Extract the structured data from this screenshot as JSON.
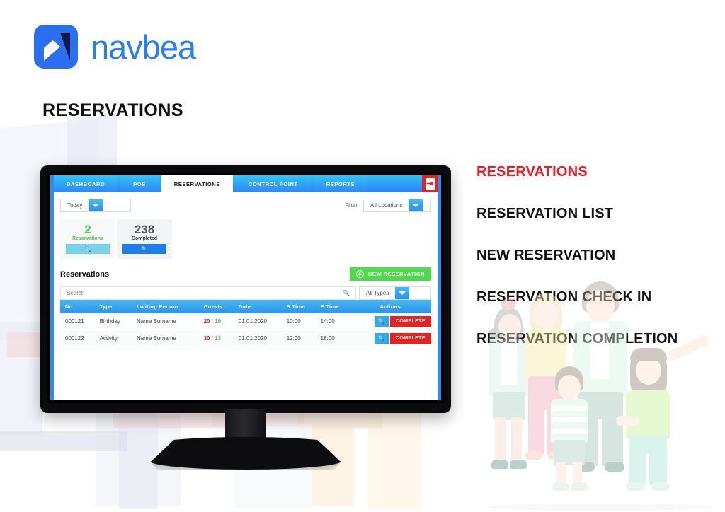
{
  "brand": {
    "name": "navbea",
    "logo_icon": "navbea-arrow-logo",
    "logo_bg": "#2a6ff0",
    "text_color": "#2a7ef0"
  },
  "page_title": "RESERVATIONS",
  "app": {
    "nav_tabs": [
      {
        "label": "DASHBOARD",
        "active": false
      },
      {
        "label": "POS",
        "active": false
      },
      {
        "label": "RESERVATIONS",
        "active": true
      },
      {
        "label": "CONTROL POINT",
        "active": false
      },
      {
        "label": "REPORTS",
        "active": false
      }
    ],
    "exit_icon": "exit-door-icon",
    "toolbar": {
      "date_select": {
        "value": "Today",
        "caret_icon": "chevron-down-icon"
      },
      "filter_label": "Filter",
      "location_select": {
        "value": "All Locations",
        "caret_icon": "chevron-down-icon"
      }
    },
    "stats": [
      {
        "value": "2",
        "label": "Reservations",
        "color": "#4ec44e",
        "button_icon": "search-icon",
        "button_color": "#77d0ec"
      },
      {
        "value": "238",
        "label": "Completed",
        "color": "#555a60",
        "button_icon": "search-icon",
        "button_color": "#1b7ef0"
      }
    ],
    "section": {
      "title": "Reservations",
      "new_button": {
        "label": "NEW RESERVATION",
        "icon": "plus-circle-icon",
        "color": "#4ddb4d"
      }
    },
    "search": {
      "placeholder": "Search",
      "value": "",
      "icon": "search-icon"
    },
    "type_select": {
      "value": "All Types",
      "caret_icon": "chevron-down-icon"
    },
    "table": {
      "columns": [
        "No",
        "Type",
        "Inviting Person",
        "Guests",
        "Date",
        "S.Time",
        "E.Time",
        "Actions"
      ],
      "rows": [
        {
          "no": "000121",
          "type": "Birthday",
          "inviting_person": "Name Surname",
          "guests_total": "20",
          "guests_sep": "/",
          "guests_checked": "19",
          "date": "01.01.2020",
          "start_time": "10:00",
          "end_time": "14:00",
          "view_icon": "search-icon",
          "action_label": "COMPLETE"
        },
        {
          "no": "000122",
          "type": "Activity",
          "inviting_person": "Name Surname",
          "guests_total": "30",
          "guests_sep": "/",
          "guests_checked": "13",
          "date": "01.01.2020",
          "start_time": "12:00",
          "end_time": "18:00",
          "view_icon": "search-icon",
          "action_label": "COMPLETE"
        }
      ]
    }
  },
  "feature_list": [
    {
      "label": "RESERVATIONS",
      "accent": true
    },
    {
      "label": "RESERVATION LIST",
      "accent": false
    },
    {
      "label": "NEW RESERVATION",
      "accent": false
    },
    {
      "label": "RESERVATION CHECK IN",
      "accent": false
    },
    {
      "label": "RESERVATION COMPLETION",
      "accent": false
    }
  ],
  "colors": {
    "accent_red": "#ee1b24",
    "nav_blue_start": "#2ec0f5",
    "nav_blue_end": "#2c80f5",
    "green": "#4ddb4d",
    "danger": "#ef1d1d"
  }
}
